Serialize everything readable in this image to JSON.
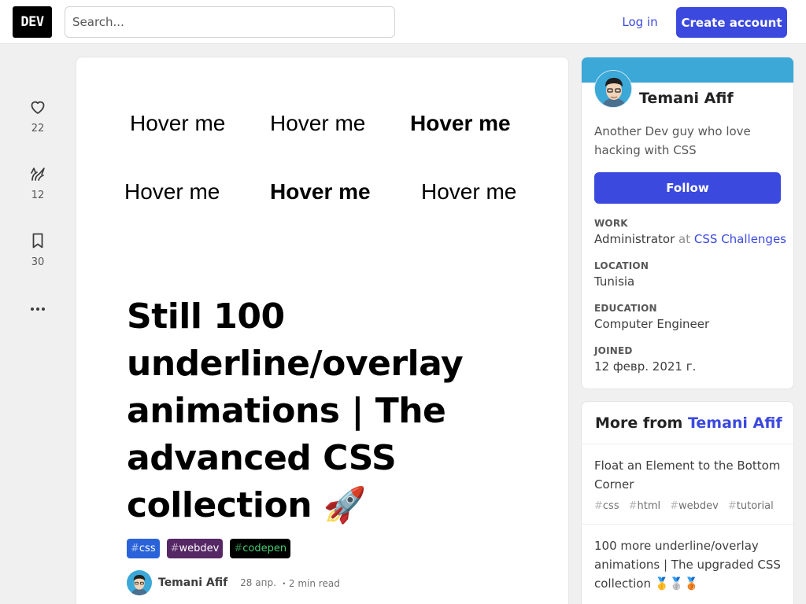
{
  "header": {
    "logo": "DEV",
    "search_placeholder": "Search...",
    "login_label": "Log in",
    "create_label": "Create account"
  },
  "reactions": {
    "likes": "22",
    "unicorns": "12",
    "bookmarks": "30"
  },
  "article": {
    "hover_items": [
      {
        "label": "Hover me",
        "bold": false
      },
      {
        "label": "Hover me",
        "bold": false
      },
      {
        "label": "Hover me",
        "bold": true
      },
      {
        "label": "Hover me",
        "bold": false
      },
      {
        "label": "Hover me",
        "bold": true
      },
      {
        "label": "Hover me",
        "bold": false
      }
    ],
    "title": "Still 100 underline/overlay animations | The advanced CSS collection 🚀",
    "tags": [
      {
        "hash": "#",
        "name": "css",
        "bg": "#2a62d9",
        "fg": "#ffffff"
      },
      {
        "hash": "#",
        "name": "webdev",
        "bg": "#562765",
        "fg": "#ffffff"
      },
      {
        "hash": "#",
        "name": "codepen",
        "bg": "#000000",
        "fg": "#47cf73"
      }
    ],
    "author": "Temani Afif",
    "date": "28 апр.",
    "read_time": "・2 min read"
  },
  "profile": {
    "name": "Temani Afif",
    "bio": "Another Dev guy who love hacking with CSS",
    "follow_label": "Follow",
    "work_label": "WORK",
    "work_role": "Administrator",
    "work_at": "at",
    "work_org": "CSS Challenges",
    "location_label": "LOCATION",
    "location": "Tunisia",
    "education_label": "EDUCATION",
    "education": "Computer Engineer",
    "joined_label": "JOINED",
    "joined": "12 февр. 2021 г."
  },
  "more_from": {
    "prefix": "More from",
    "author": "Temani Afif",
    "items": [
      {
        "title": "Float an Element to the Bottom Corner",
        "tags": [
          "css",
          "html",
          "webdev",
          "tutorial"
        ]
      },
      {
        "title": "100 more underline/overlay animations | The upgraded CSS collection 🥇🥈🥉",
        "tags": []
      }
    ]
  },
  "colors": {
    "accent": "#3b49df",
    "profile_banner": "#3ba8d8"
  }
}
